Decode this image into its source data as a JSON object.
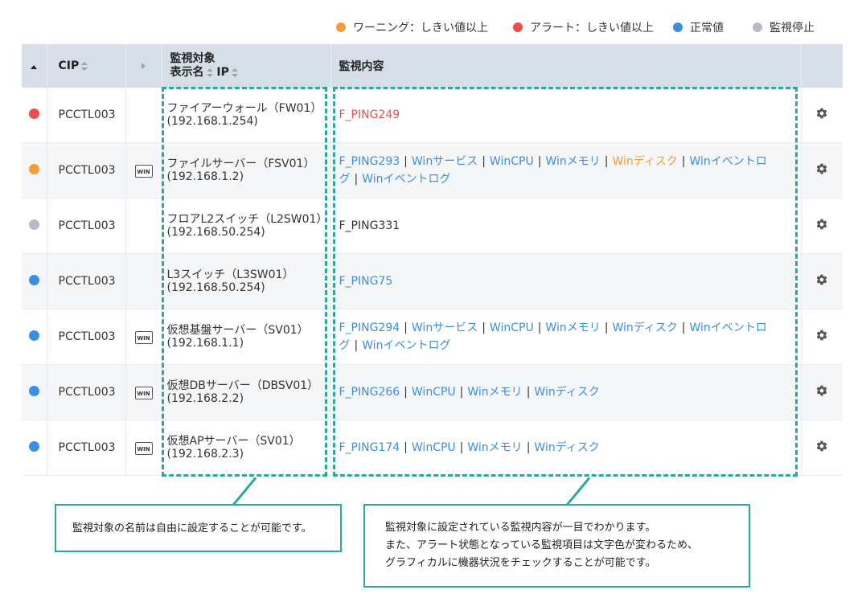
{
  "legend": [
    {
      "label": "ワーニング：しきい値以上",
      "color": "#f39c3a"
    },
    {
      "label": "アラート：しきい値以上",
      "color": "#f04a4a"
    },
    {
      "label": "正常値",
      "color": "#3a8fde"
    },
    {
      "label": "監視停止",
      "color": "#b5bcc5"
    }
  ],
  "table": {
    "headers": {
      "cip": "CIP",
      "target_line1": "監視対象",
      "target_line2_name": "表示名",
      "target_line2_ip": "IP",
      "monitor": "監視内容"
    },
    "rows": [
      {
        "status_color": "#f04a4a",
        "cip": "PCCTL003",
        "win": "",
        "name": "ファイアーウォール（FW01）",
        "ip": "(192.168.1.254)",
        "monitors": [
          {
            "text": "F_PING249",
            "status": "alert"
          }
        ]
      },
      {
        "status_color": "#f39c3a",
        "cip": "PCCTL003",
        "win": "WIN",
        "name": "ファイルサーバー（FSV01）",
        "ip": "(192.168.1.2)",
        "monitors": [
          {
            "text": "F_PING293",
            "status": "normal"
          },
          {
            "text": "Winサービス",
            "status": "normal"
          },
          {
            "text": "WinCPU",
            "status": "normal"
          },
          {
            "text": "Winメモリ",
            "status": "normal"
          },
          {
            "text": "Winディスク",
            "status": "warn"
          },
          {
            "text": "Winイベントログ",
            "status": "normal"
          },
          {
            "text": "Winイベントログ",
            "status": "normal"
          }
        ]
      },
      {
        "status_color": "#b5bcc5",
        "cip": "PCCTL003",
        "win": "",
        "name": "フロアL2スイッチ（L2SW01）",
        "ip": "(192.168.50.254)",
        "monitors": [
          {
            "text": "F_PING331",
            "status": "stop"
          }
        ]
      },
      {
        "status_color": "#3a8fde",
        "cip": "PCCTL003",
        "win": "",
        "name": "L3スイッチ（L3SW01）",
        "ip": "(192.168.50.254)",
        "monitors": [
          {
            "text": "F_PING75",
            "status": "normal"
          }
        ]
      },
      {
        "status_color": "#3a8fde",
        "cip": "PCCTL003",
        "win": "WIN",
        "name": "仮想基盤サーバー（SV01）",
        "ip": "(192.168.1.1)",
        "monitors": [
          {
            "text": "F_PING294",
            "status": "normal"
          },
          {
            "text": "Winサービス",
            "status": "normal"
          },
          {
            "text": "WinCPU",
            "status": "normal"
          },
          {
            "text": "Winメモリ",
            "status": "normal"
          },
          {
            "text": "Winディスク",
            "status": "normal"
          },
          {
            "text": "Winイベントログ",
            "status": "normal"
          },
          {
            "text": "Winイベントログ",
            "status": "normal"
          }
        ]
      },
      {
        "status_color": "#3a8fde",
        "cip": "PCCTL003",
        "win": "WIN",
        "name": "仮想DBサーバー（DBSV01）",
        "ip": "(192.168.2.2)",
        "monitors": [
          {
            "text": "F_PING266",
            "status": "normal"
          },
          {
            "text": "WinCPU",
            "status": "normal"
          },
          {
            "text": "Winメモリ",
            "status": "normal"
          },
          {
            "text": "Winディスク",
            "status": "normal"
          }
        ]
      },
      {
        "status_color": "#3a8fde",
        "cip": "PCCTL003",
        "win": "WIN",
        "name": "仮想APサーバー（SV01）",
        "ip": "(192.168.2.3)",
        "monitors": [
          {
            "text": "F_PING174",
            "status": "normal"
          },
          {
            "text": "WinCPU",
            "status": "normal"
          },
          {
            "text": "Winメモリ",
            "status": "normal"
          },
          {
            "text": "Winディスク",
            "status": "normal"
          }
        ]
      }
    ]
  },
  "callouts": {
    "left": "監視対象の名前は自由に設定することが可能です。",
    "right_lines": [
      "監視対象に設定されている監視内容が一目でわかります。",
      "また、アラート状態となっている監視項目は文字色が変わるため、",
      "グラフィカルに機器状況をチェックすることが可能です。"
    ]
  }
}
